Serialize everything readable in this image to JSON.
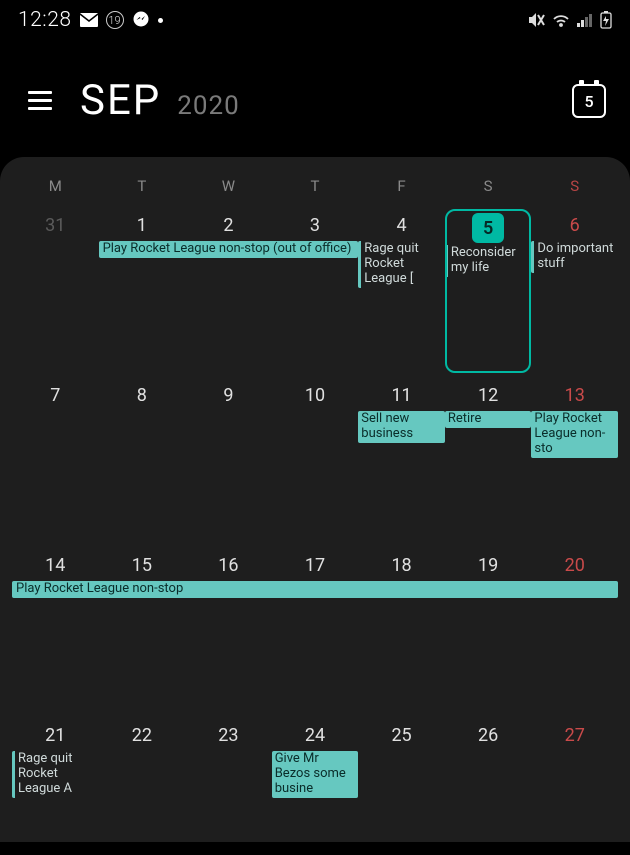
{
  "status": {
    "time": "12:28",
    "notif_count": "19"
  },
  "header": {
    "month": "SEP",
    "year": "2020",
    "today_day": "5"
  },
  "day_headers": [
    "M",
    "T",
    "W",
    "T",
    "F",
    "S",
    "S"
  ],
  "weeks": [
    {
      "days": [
        {
          "num": "31",
          "prev": true
        },
        {
          "num": "1"
        },
        {
          "num": "2"
        },
        {
          "num": "3"
        },
        {
          "num": "4"
        },
        {
          "num": "5",
          "today": true
        },
        {
          "num": "6",
          "sunday": true
        }
      ],
      "span_events": [
        {
          "label": "Play Rocket League non-stop (out of office)",
          "start": 1,
          "end": 3
        }
      ],
      "cell_events": {
        "4": [
          {
            "style": "bar",
            "label": "Rage quit Rocket League ["
          }
        ],
        "5": [
          {
            "style": "bar",
            "label": "Reconsider my life"
          }
        ],
        "6": [
          {
            "style": "bar",
            "label": "Do important stuff"
          }
        ]
      }
    },
    {
      "days": [
        {
          "num": "7"
        },
        {
          "num": "8"
        },
        {
          "num": "9"
        },
        {
          "num": "10"
        },
        {
          "num": "11"
        },
        {
          "num": "12"
        },
        {
          "num": "13",
          "sunday": true
        }
      ],
      "cell_events": {
        "4": [
          {
            "style": "teal",
            "label": "Sell new business"
          }
        ],
        "5": [
          {
            "style": "teal",
            "label": "Retire"
          }
        ],
        "6": [
          {
            "style": "teal",
            "label": "Play Rocket League non-sto"
          }
        ]
      }
    },
    {
      "days": [
        {
          "num": "14"
        },
        {
          "num": "15"
        },
        {
          "num": "16"
        },
        {
          "num": "17"
        },
        {
          "num": "18"
        },
        {
          "num": "19"
        },
        {
          "num": "20",
          "sunday": true
        }
      ],
      "span_events": [
        {
          "label": "Play Rocket League non-stop",
          "start": 0,
          "end": 6
        }
      ]
    },
    {
      "days": [
        {
          "num": "21"
        },
        {
          "num": "22"
        },
        {
          "num": "23"
        },
        {
          "num": "24"
        },
        {
          "num": "25"
        },
        {
          "num": "26"
        },
        {
          "num": "27",
          "sunday": true
        }
      ],
      "cell_events": {
        "0": [
          {
            "style": "bar",
            "label": "Rage quit Rocket League A"
          }
        ],
        "3": [
          {
            "style": "teal",
            "label": "Give Mr Bezos some busine"
          }
        ]
      }
    }
  ]
}
